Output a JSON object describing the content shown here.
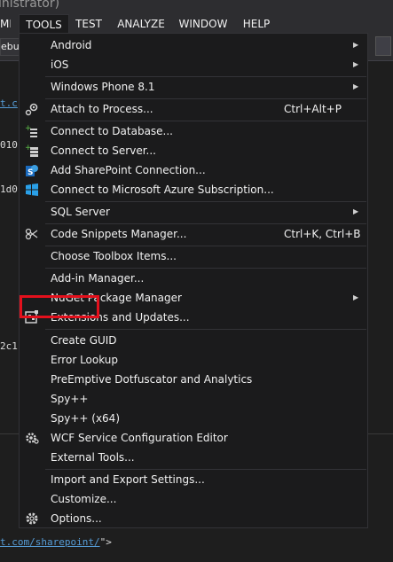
{
  "title_fragment": "inistrator)",
  "menubar": {
    "items": [
      {
        "label": "ML"
      },
      {
        "label": "TOOLS"
      },
      {
        "label": "TEST"
      },
      {
        "label": "ANALYZE"
      },
      {
        "label": "WINDOW"
      },
      {
        "label": "HELP"
      }
    ]
  },
  "toolbar": {
    "combo_fragment": "ebu"
  },
  "editor": {
    "fragments": [
      "t.c",
      "010",
      "1d0",
      "2c1"
    ],
    "bottom_line_link": "t.com/sharepoint/",
    "bottom_line_tail": "\">"
  },
  "tools_menu": {
    "items": [
      {
        "label": "Android",
        "submenu": true
      },
      {
        "label": "iOS",
        "submenu": true
      },
      {
        "label": "Windows Phone 8.1",
        "submenu": true
      },
      {
        "label": "Attach to Process...",
        "shortcut": "Ctrl+Alt+P",
        "icon": "attach-process-icon"
      },
      {
        "label": "Connect to Database...",
        "icon": "connect-database-icon"
      },
      {
        "label": "Connect to Server...",
        "icon": "connect-server-icon"
      },
      {
        "label": "Add SharePoint Connection...",
        "icon": "sharepoint-icon"
      },
      {
        "label": "Connect to Microsoft Azure Subscription...",
        "icon": "windows-azure-icon"
      },
      {
        "label": "SQL Server",
        "submenu": true
      },
      {
        "label": "Code Snippets Manager...",
        "shortcut": "Ctrl+K, Ctrl+B",
        "icon": "code-snippets-icon"
      },
      {
        "label": "Choose Toolbox Items..."
      },
      {
        "label": "Add-in Manager..."
      },
      {
        "label": "NuGet Package Manager",
        "submenu": true
      },
      {
        "label": "Extensions and Updates...",
        "icon": "extensions-icon"
      },
      {
        "label": "Create GUID",
        "highlighted": true
      },
      {
        "label": "Error Lookup"
      },
      {
        "label": "PreEmptive Dotfuscator and Analytics"
      },
      {
        "label": "Spy++"
      },
      {
        "label": "Spy++ (x64)"
      },
      {
        "label": "WCF Service Configuration Editor",
        "icon": "wcf-gear-icon"
      },
      {
        "label": "External Tools..."
      },
      {
        "label": "Import and Export Settings..."
      },
      {
        "label": "Customize..."
      },
      {
        "label": "Options...",
        "icon": "options-gear-icon"
      }
    ],
    "arrow_glyph": "▶"
  },
  "colors": {
    "background": "#1e1e1e",
    "menu_bg": "#1b1b1c",
    "menubar_bg": "#2d2d30",
    "highlight_border": "#e3101c",
    "link": "#569cd6"
  }
}
